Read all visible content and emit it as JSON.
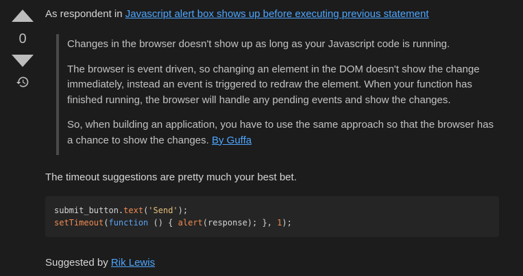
{
  "vote": {
    "count": "0",
    "upvote_icon": "arrow-up-icon",
    "downvote_icon": "arrow-down-icon",
    "history_icon": "history-icon"
  },
  "header": {
    "prefix": "As respondent in ",
    "question_link": "Javascript alert box shows up before executing previous statement"
  },
  "quote": {
    "paragraphs": [
      "Changes in the browser doesn't show up as long as your Javascript code is running.",
      "The browser is event driven, so changing an element in the DOM doesn't show the change immediately, instead an event is triggered to redraw the element. When your function has finished running, the browser will handle any pending events and show the changes.",
      "So, when building an application, you have to use the same approach so that the browser has a chance to show the changes. "
    ],
    "author_link": "By Guffa"
  },
  "body_text": "The timeout suggestions are pretty much your best bet.",
  "code": {
    "line1": {
      "obj": "submit_button.",
      "fn": "text",
      "open": "(",
      "str": "'Send'",
      "close": ");"
    },
    "line2": {
      "fn": "setTimeout",
      "open": "(",
      "kw": "function",
      "mid": " () { ",
      "fn2": "alert",
      "args": "(response); }, ",
      "num": "1",
      "end": ");"
    }
  },
  "footer": {
    "prefix": "Suggested by ",
    "author_link": "Rik Lewis"
  },
  "colors": {
    "background": "#1c1c1c",
    "link": "#4ea6ff",
    "code_background": "#252525"
  }
}
